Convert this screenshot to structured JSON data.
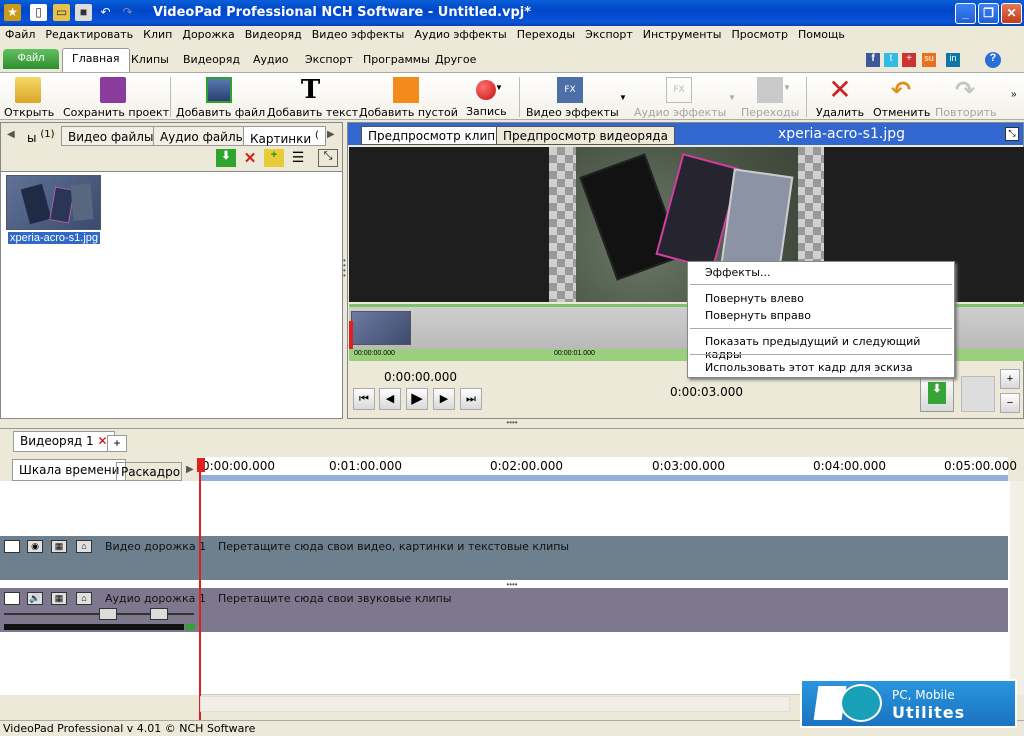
{
  "window": {
    "title": "VideoPad Professional NCH Software - Untitled.vpj*"
  },
  "menu": [
    "Файл",
    "Редактировать",
    "Клип",
    "Дорожка",
    "Видеоряд",
    "Видео эффекты",
    "Аудио эффекты",
    "Переходы",
    "Экспорт",
    "Инструменты",
    "Просмотр",
    "Помощь"
  ],
  "ribbon_tabs": {
    "file": "Файл",
    "home": "Главная",
    "clips": "Клипы",
    "sequence": "Видеоряд",
    "audio": "Аудио",
    "export": "Экспорт",
    "programs": "Программы",
    "other": "Другое"
  },
  "toolbar": {
    "open": "Открыть",
    "save": "Сохранить проект",
    "add_file": "Добавить файл",
    "add_text": "Добавить текст",
    "add_blank": "Добавить пустой",
    "record": "Запись",
    "video_effects": "Видео эффекты",
    "audio_effects": "Аудио эффекты",
    "transitions": "Переходы",
    "delete": "Удалить",
    "undo": "Отменить",
    "redo": "Повторить"
  },
  "bin": {
    "tab_partial": "ы",
    "tab_partial_count": "(1)",
    "tab_video": "Видео файлы",
    "tab_audio": "Аудио файлы",
    "tab_pictures": "Картинки",
    "tab_pictures_count": "(",
    "thumbnail_label": "xperia-acro-s1.jpg"
  },
  "preview": {
    "tab_clip": "Предпросмотр клипа",
    "tab_sequence": "Предпросмотр видеоряда",
    "filename": "xperia-acro-s1.jpg",
    "strip_time_start": "00:00:00.000",
    "strip_time_mid": "00:00:01.000",
    "current_time": "0:00:00.000",
    "duration": "0:00:03.000"
  },
  "context_menu": {
    "effects": "Эффекты...",
    "rotate_left": "Повернуть влево",
    "rotate_right": "Повернуть вправо",
    "show_frames": "Показать предыдущий и следующий кадры",
    "use_thumbnail": "Использовать этот кадр для эскиза"
  },
  "sequence": {
    "tab": "Видеоряд 1",
    "add": "+",
    "timeline_tab": "Шкала времени",
    "storyboard_tab": "Раскадро"
  },
  "ruler": [
    "0:00:00.000",
    "0:01:00.000",
    "0:02:00.000",
    "0:03:00.000",
    "0:04:00.000",
    "0:05:00.000"
  ],
  "tracks": {
    "video_label": "Видео дорожка 1",
    "video_msg": "Перетащите сюда свои видео, картинки и текстовые клипы",
    "audio_label": "Аудио дорожка 1",
    "audio_msg": "Перетащите сюда свои звуковые клипы"
  },
  "status": "VideoPad Professional v 4.01 © NCH Software",
  "watermark": {
    "line1": "PC, Mobile",
    "line2": "Utilites"
  },
  "colors": {
    "titlebar": "#0a54d8",
    "accent_green": "#2e8f2e",
    "timeline_track": "#6e7f8e",
    "audio_track": "#7e788f",
    "playhead": "#e02020"
  }
}
